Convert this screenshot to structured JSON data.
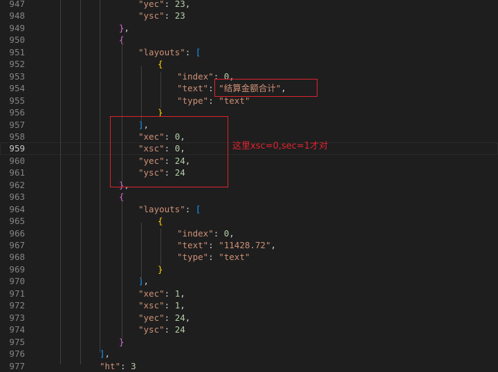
{
  "lines": [
    {
      "n": "947",
      "segs": [
        {
          "c": "s",
          "t": "\"yec\""
        },
        {
          "c": "p",
          "t": ": "
        },
        {
          "c": "n",
          "t": "23"
        },
        {
          "c": "p",
          "t": ","
        }
      ]
    },
    {
      "n": "948",
      "segs": [
        {
          "c": "s",
          "t": "\"ysc\""
        },
        {
          "c": "p",
          "t": ": "
        },
        {
          "c": "n",
          "t": "23"
        }
      ]
    },
    {
      "n": "949",
      "segs": [
        {
          "c": "b1",
          "t": "}"
        },
        {
          "c": "p",
          "t": ","
        }
      ]
    },
    {
      "n": "950",
      "segs": [
        {
          "c": "b1",
          "t": "{"
        }
      ]
    },
    {
      "n": "951",
      "segs": [
        {
          "c": "s",
          "t": "\"layouts\""
        },
        {
          "c": "p",
          "t": ": "
        },
        {
          "c": "b2",
          "t": "["
        }
      ]
    },
    {
      "n": "952",
      "segs": [
        {
          "c": "b3",
          "t": "{"
        }
      ]
    },
    {
      "n": "953",
      "segs": [
        {
          "c": "s",
          "t": "\"index\""
        },
        {
          "c": "p",
          "t": ": "
        },
        {
          "c": "n",
          "t": "0"
        },
        {
          "c": "p",
          "t": ","
        }
      ]
    },
    {
      "n": "954",
      "segs": [
        {
          "c": "s",
          "t": "\"text\""
        },
        {
          "c": "p",
          "t": ": "
        },
        {
          "c": "s",
          "t": "\"结算金额合计\""
        },
        {
          "c": "p",
          "t": ","
        }
      ]
    },
    {
      "n": "955",
      "segs": [
        {
          "c": "s",
          "t": "\"type\""
        },
        {
          "c": "p",
          "t": ": "
        },
        {
          "c": "s",
          "t": "\"text\""
        }
      ]
    },
    {
      "n": "956",
      "segs": [
        {
          "c": "b3",
          "t": "}"
        }
      ]
    },
    {
      "n": "957",
      "segs": [
        {
          "c": "b2",
          "t": "]"
        },
        {
          "c": "p",
          "t": ","
        }
      ]
    },
    {
      "n": "958",
      "segs": [
        {
          "c": "s",
          "t": "\"xec\""
        },
        {
          "c": "p",
          "t": ": "
        },
        {
          "c": "n",
          "t": "0"
        },
        {
          "c": "p",
          "t": ","
        }
      ]
    },
    {
      "n": "959",
      "segs": [
        {
          "c": "s",
          "t": "\"xsc\""
        },
        {
          "c": "p",
          "t": ": "
        },
        {
          "c": "n",
          "t": "0"
        },
        {
          "c": "p",
          "t": ","
        }
      ]
    },
    {
      "n": "960",
      "segs": [
        {
          "c": "s",
          "t": "\"yec\""
        },
        {
          "c": "p",
          "t": ": "
        },
        {
          "c": "n",
          "t": "24"
        },
        {
          "c": "p",
          "t": ","
        }
      ]
    },
    {
      "n": "961",
      "segs": [
        {
          "c": "s",
          "t": "\"ysc\""
        },
        {
          "c": "p",
          "t": ": "
        },
        {
          "c": "n",
          "t": "24"
        }
      ]
    },
    {
      "n": "962",
      "segs": [
        {
          "c": "b1",
          "t": "}"
        },
        {
          "c": "p",
          "t": ","
        }
      ]
    },
    {
      "n": "963",
      "segs": [
        {
          "c": "b1",
          "t": "{"
        }
      ]
    },
    {
      "n": "964",
      "segs": [
        {
          "c": "s",
          "t": "\"layouts\""
        },
        {
          "c": "p",
          "t": ": "
        },
        {
          "c": "b2",
          "t": "["
        }
      ]
    },
    {
      "n": "965",
      "segs": [
        {
          "c": "b3",
          "t": "{"
        }
      ]
    },
    {
      "n": "966",
      "segs": [
        {
          "c": "s",
          "t": "\"index\""
        },
        {
          "c": "p",
          "t": ": "
        },
        {
          "c": "n",
          "t": "0"
        },
        {
          "c": "p",
          "t": ","
        }
      ]
    },
    {
      "n": "967",
      "segs": [
        {
          "c": "s",
          "t": "\"text\""
        },
        {
          "c": "p",
          "t": ": "
        },
        {
          "c": "s",
          "t": "\"11428.72\""
        },
        {
          "c": "p",
          "t": ","
        }
      ]
    },
    {
      "n": "968",
      "segs": [
        {
          "c": "s",
          "t": "\"type\""
        },
        {
          "c": "p",
          "t": ": "
        },
        {
          "c": "s",
          "t": "\"text\""
        }
      ]
    },
    {
      "n": "969",
      "segs": [
        {
          "c": "b3",
          "t": "}"
        }
      ]
    },
    {
      "n": "970",
      "segs": [
        {
          "c": "b2",
          "t": "]"
        },
        {
          "c": "p",
          "t": ","
        }
      ]
    },
    {
      "n": "971",
      "segs": [
        {
          "c": "s",
          "t": "\"xec\""
        },
        {
          "c": "p",
          "t": ": "
        },
        {
          "c": "n",
          "t": "1"
        },
        {
          "c": "p",
          "t": ","
        }
      ]
    },
    {
      "n": "972",
      "segs": [
        {
          "c": "s",
          "t": "\"xsc\""
        },
        {
          "c": "p",
          "t": ": "
        },
        {
          "c": "n",
          "t": "1"
        },
        {
          "c": "p",
          "t": ","
        }
      ]
    },
    {
      "n": "973",
      "segs": [
        {
          "c": "s",
          "t": "\"yec\""
        },
        {
          "c": "p",
          "t": ": "
        },
        {
          "c": "n",
          "t": "24"
        },
        {
          "c": "p",
          "t": ","
        }
      ]
    },
    {
      "n": "974",
      "segs": [
        {
          "c": "s",
          "t": "\"ysc\""
        },
        {
          "c": "p",
          "t": ": "
        },
        {
          "c": "n",
          "t": "24"
        }
      ]
    },
    {
      "n": "975",
      "segs": [
        {
          "c": "b1",
          "t": "}"
        }
      ]
    },
    {
      "n": "976",
      "segs": [
        {
          "c": "b2",
          "t": "]"
        },
        {
          "c": "p",
          "t": ","
        }
      ]
    },
    {
      "n": "977",
      "segs": [
        {
          "c": "s",
          "t": "\"ht\""
        },
        {
          "c": "p",
          "t": ": "
        },
        {
          "c": "n",
          "t": "3"
        }
      ]
    }
  ],
  "active_line": "959",
  "annotation": "这里xsc=0,sec=1才对",
  "colors": {
    "background": "#1e1e1e",
    "annotation_red": "#e0242f",
    "string": "#ce9178",
    "number": "#b5cea8"
  }
}
